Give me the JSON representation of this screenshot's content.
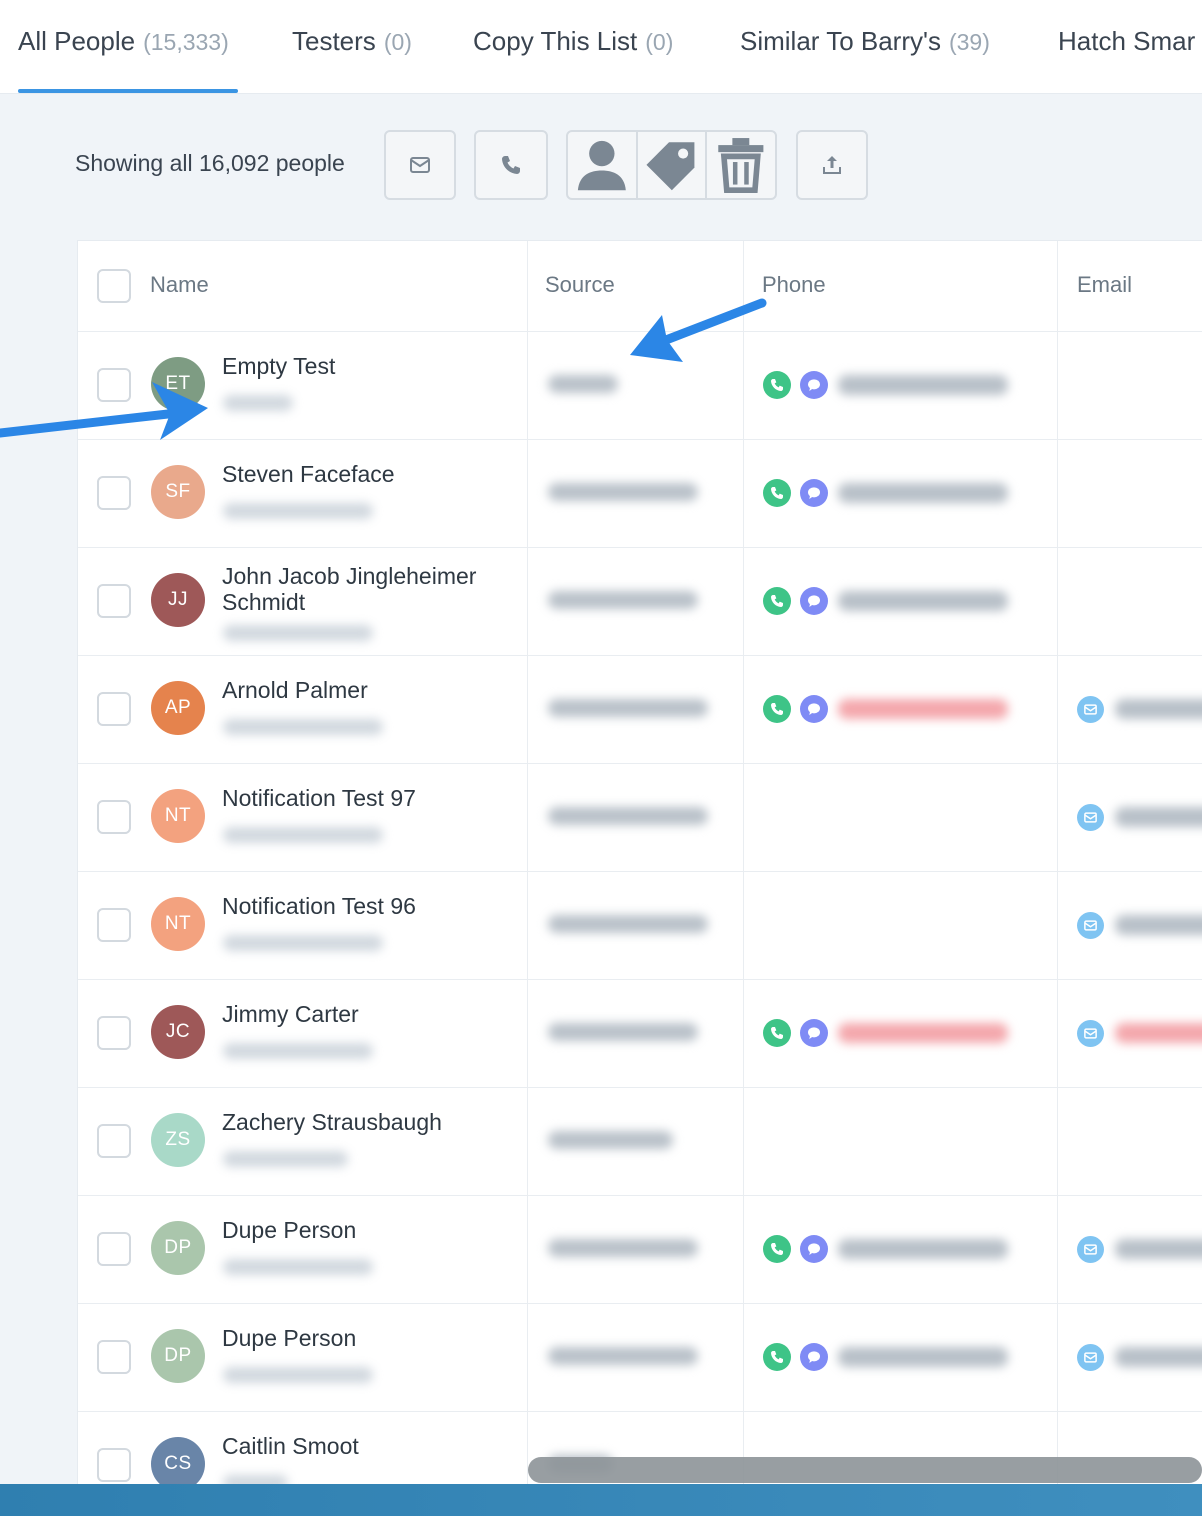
{
  "tabs": [
    {
      "label": "All People",
      "count": "(15,333)",
      "active": true
    },
    {
      "label": "Testers",
      "count": "(0)"
    },
    {
      "label": "Copy This List",
      "count": "(0)"
    },
    {
      "label": "Similar To Barry's",
      "count": "(39)"
    },
    {
      "label": "Hatch Smar",
      "count": ""
    }
  ],
  "toolbar": {
    "showing_label": "Showing all 16,092 people",
    "icons": [
      "email-icon",
      "phone-icon",
      "user-icon",
      "tag-icon",
      "trash-icon",
      "upload-icon"
    ]
  },
  "table": {
    "headers": {
      "name": "Name",
      "source": "Source",
      "phone": "Phone",
      "email": "Email"
    },
    "rows": [
      {
        "initials": "ET",
        "name": "Empty Test",
        "color": "#7e9c83",
        "phone": true,
        "phone_red": false,
        "email": false,
        "email_red": false
      },
      {
        "initials": "SF",
        "name": "Steven Faceface",
        "color": "#e9a98c",
        "phone": true,
        "phone_red": false,
        "email": false,
        "email_red": false
      },
      {
        "initials": "JJ",
        "name": "John Jacob Jingleheimer Schmidt",
        "color": "#9e5858",
        "phone": true,
        "phone_red": false,
        "email": false,
        "email_red": false
      },
      {
        "initials": "AP",
        "name": "Arnold Palmer",
        "color": "#e5834d",
        "phone": true,
        "phone_red": true,
        "email": true,
        "email_red": false
      },
      {
        "initials": "NT",
        "name": "Notification Test 97",
        "color": "#f3a27f",
        "phone": false,
        "phone_red": false,
        "email": true,
        "email_red": false
      },
      {
        "initials": "NT",
        "name": "Notification Test 96",
        "color": "#f3a27f",
        "phone": false,
        "phone_red": false,
        "email": true,
        "email_red": false
      },
      {
        "initials": "JC",
        "name": "Jimmy Carter",
        "color": "#9e5858",
        "phone": true,
        "phone_red": true,
        "email": true,
        "email_red": true
      },
      {
        "initials": "ZS",
        "name": "Zachery Strausbaugh",
        "color": "#a9d9c8",
        "phone": false,
        "phone_red": false,
        "email": false,
        "email_red": false
      },
      {
        "initials": "DP",
        "name": "Dupe Person",
        "color": "#aac6ac",
        "phone": true,
        "phone_red": false,
        "email": true,
        "email_red": false
      },
      {
        "initials": "DP",
        "name": "Dupe Person",
        "color": "#aac6ac",
        "phone": true,
        "phone_red": false,
        "email": true,
        "email_red": false
      },
      {
        "initials": "CS",
        "name": "Caitlin Smoot",
        "color": "#6985a8",
        "phone": false,
        "phone_red": false,
        "email": false,
        "email_red": false
      }
    ]
  },
  "colors": {
    "accent": "#3b95e3",
    "call": "#3ec487",
    "message": "#7f8bf5",
    "email": "#7fc4f2",
    "annotation_arrow": "#2b86e6"
  }
}
